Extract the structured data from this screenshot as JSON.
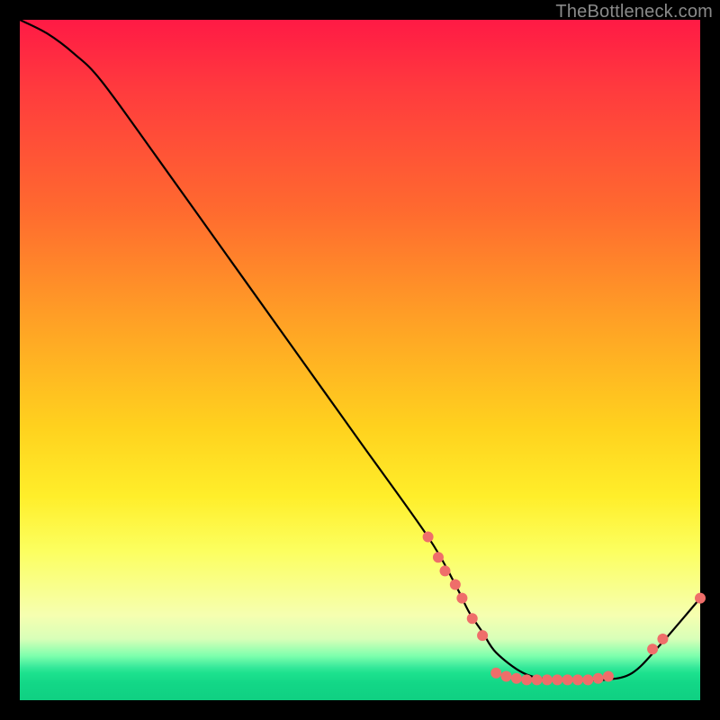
{
  "watermark": "TheBottleneck.com",
  "chart_data": {
    "type": "line",
    "title": "",
    "xlabel": "",
    "ylabel": "",
    "xlim": [
      0,
      100
    ],
    "ylim": [
      0,
      100
    ],
    "grid": false,
    "legend": false,
    "series": [
      {
        "name": "curve",
        "color": "#000000",
        "x": [
          0,
          4,
          8,
          12,
          20,
          30,
          40,
          50,
          60,
          64,
          66,
          68,
          70,
          74,
          78,
          82,
          86,
          90,
          94,
          100
        ],
        "y": [
          100,
          98,
          95,
          91,
          80,
          66,
          52,
          38,
          24,
          17,
          13,
          10,
          7,
          4,
          3,
          3,
          3,
          4,
          8,
          15
        ]
      }
    ],
    "markers": [
      {
        "name": "dots",
        "color": "#ef6e6a",
        "radius_px": 6,
        "points": [
          {
            "x": 60.0,
            "y": 24.0
          },
          {
            "x": 61.5,
            "y": 21.0
          },
          {
            "x": 62.5,
            "y": 19.0
          },
          {
            "x": 64.0,
            "y": 17.0
          },
          {
            "x": 65.0,
            "y": 15.0
          },
          {
            "x": 66.5,
            "y": 12.0
          },
          {
            "x": 68.0,
            "y": 9.5
          },
          {
            "x": 70.0,
            "y": 4.0
          },
          {
            "x": 71.5,
            "y": 3.5
          },
          {
            "x": 73.0,
            "y": 3.2
          },
          {
            "x": 74.5,
            "y": 3.0
          },
          {
            "x": 76.0,
            "y": 3.0
          },
          {
            "x": 77.5,
            "y": 3.0
          },
          {
            "x": 79.0,
            "y": 3.0
          },
          {
            "x": 80.5,
            "y": 3.0
          },
          {
            "x": 82.0,
            "y": 3.0
          },
          {
            "x": 83.5,
            "y": 3.0
          },
          {
            "x": 85.0,
            "y": 3.2
          },
          {
            "x": 86.5,
            "y": 3.5
          },
          {
            "x": 93.0,
            "y": 7.5
          },
          {
            "x": 94.5,
            "y": 9.0
          },
          {
            "x": 100.0,
            "y": 15.0
          }
        ]
      }
    ]
  }
}
